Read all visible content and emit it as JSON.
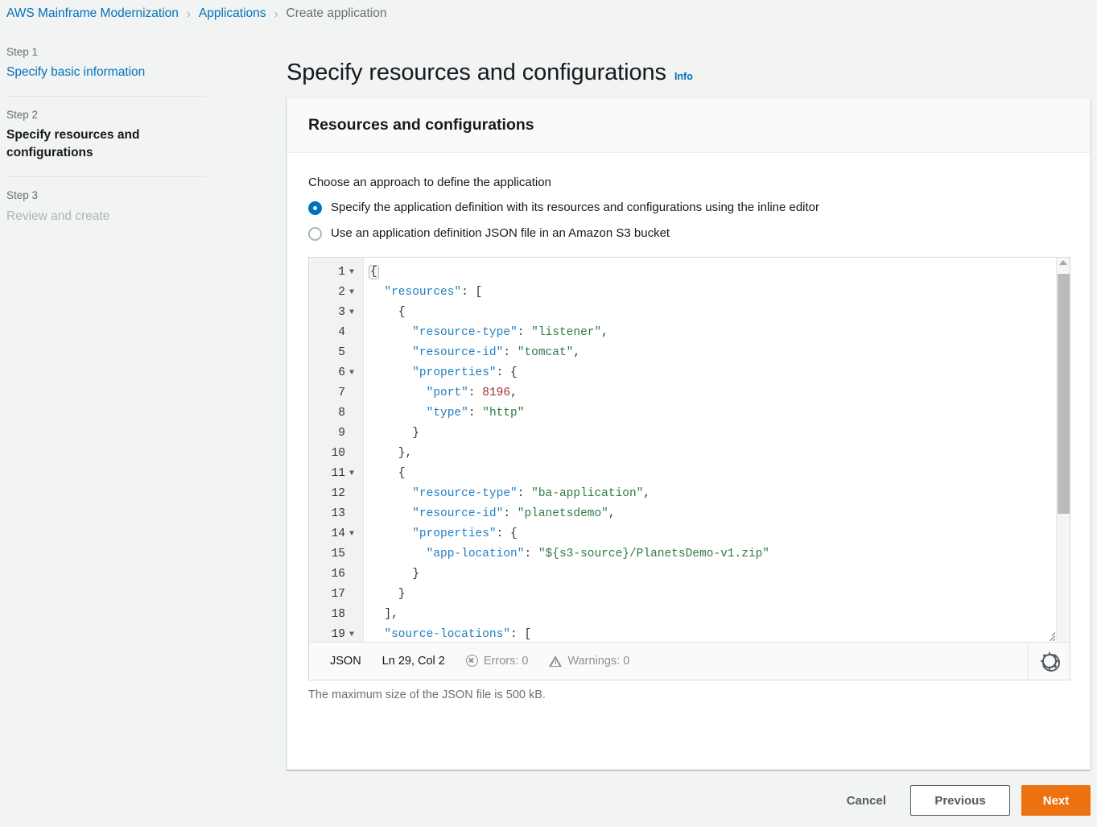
{
  "breadcrumb": {
    "items": [
      {
        "label": "AWS Mainframe Modernization",
        "current": false
      },
      {
        "label": "Applications",
        "current": false
      },
      {
        "label": "Create application",
        "current": true
      }
    ],
    "separator": "›"
  },
  "wizard": {
    "steps": [
      {
        "num": "Step 1",
        "title": "Specify basic information",
        "state": "link"
      },
      {
        "num": "Step 2",
        "title": "Specify resources and configurations",
        "state": "active"
      },
      {
        "num": "Step 3",
        "title": "Review and create",
        "state": "disabled"
      }
    ]
  },
  "page": {
    "heading": "Specify resources and configurations",
    "info_label": "Info"
  },
  "panel": {
    "title": "Resources and configurations",
    "approach_label": "Choose an approach to define the application",
    "options": [
      {
        "label": "Specify the application definition with its resources and configurations using the inline editor",
        "checked": true
      },
      {
        "label": "Use an application definition JSON file in an Amazon S3 bucket",
        "checked": false
      }
    ],
    "max_size_note": "The maximum size of the JSON file is 500 kB."
  },
  "editor": {
    "language": "JSON",
    "cursor_position": "Ln 29, Col 2",
    "errors_label": "Errors: 0",
    "warnings_label": "Warnings: 0",
    "settings_icon": "gear-icon",
    "lines": [
      {
        "n": "1",
        "fold": true,
        "tokens": [
          {
            "t": "{",
            "c": "punc",
            "hl": true
          }
        ]
      },
      {
        "n": "2",
        "fold": true,
        "tokens": [
          {
            "t": "  ",
            "c": "punc"
          },
          {
            "t": "\"resources\"",
            "c": "key"
          },
          {
            "t": ": [",
            "c": "punc"
          }
        ]
      },
      {
        "n": "3",
        "fold": true,
        "tokens": [
          {
            "t": "    {",
            "c": "punc"
          }
        ]
      },
      {
        "n": "4",
        "fold": false,
        "tokens": [
          {
            "t": "      ",
            "c": "punc"
          },
          {
            "t": "\"resource-type\"",
            "c": "key"
          },
          {
            "t": ": ",
            "c": "punc"
          },
          {
            "t": "\"listener\"",
            "c": "str"
          },
          {
            "t": ",",
            "c": "punc"
          }
        ]
      },
      {
        "n": "5",
        "fold": false,
        "tokens": [
          {
            "t": "      ",
            "c": "punc"
          },
          {
            "t": "\"resource-id\"",
            "c": "key"
          },
          {
            "t": ": ",
            "c": "punc"
          },
          {
            "t": "\"tomcat\"",
            "c": "str"
          },
          {
            "t": ",",
            "c": "punc"
          }
        ]
      },
      {
        "n": "6",
        "fold": true,
        "tokens": [
          {
            "t": "      ",
            "c": "punc"
          },
          {
            "t": "\"properties\"",
            "c": "key"
          },
          {
            "t": ": {",
            "c": "punc"
          }
        ]
      },
      {
        "n": "7",
        "fold": false,
        "tokens": [
          {
            "t": "        ",
            "c": "punc"
          },
          {
            "t": "\"port\"",
            "c": "key"
          },
          {
            "t": ": ",
            "c": "punc"
          },
          {
            "t": "8196",
            "c": "num"
          },
          {
            "t": ",",
            "c": "punc"
          }
        ]
      },
      {
        "n": "8",
        "fold": false,
        "tokens": [
          {
            "t": "        ",
            "c": "punc"
          },
          {
            "t": "\"type\"",
            "c": "key"
          },
          {
            "t": ": ",
            "c": "punc"
          },
          {
            "t": "\"http\"",
            "c": "str"
          }
        ]
      },
      {
        "n": "9",
        "fold": false,
        "tokens": [
          {
            "t": "      }",
            "c": "punc"
          }
        ]
      },
      {
        "n": "10",
        "fold": false,
        "tokens": [
          {
            "t": "    },",
            "c": "punc"
          }
        ]
      },
      {
        "n": "11",
        "fold": true,
        "tokens": [
          {
            "t": "    {",
            "c": "punc"
          }
        ]
      },
      {
        "n": "12",
        "fold": false,
        "tokens": [
          {
            "t": "      ",
            "c": "punc"
          },
          {
            "t": "\"resource-type\"",
            "c": "key"
          },
          {
            "t": ": ",
            "c": "punc"
          },
          {
            "t": "\"ba-application\"",
            "c": "str"
          },
          {
            "t": ",",
            "c": "punc"
          }
        ]
      },
      {
        "n": "13",
        "fold": false,
        "tokens": [
          {
            "t": "      ",
            "c": "punc"
          },
          {
            "t": "\"resource-id\"",
            "c": "key"
          },
          {
            "t": ": ",
            "c": "punc"
          },
          {
            "t": "\"planetsdemo\"",
            "c": "str"
          },
          {
            "t": ",",
            "c": "punc"
          }
        ]
      },
      {
        "n": "14",
        "fold": true,
        "tokens": [
          {
            "t": "      ",
            "c": "punc"
          },
          {
            "t": "\"properties\"",
            "c": "key"
          },
          {
            "t": ": {",
            "c": "punc"
          }
        ]
      },
      {
        "n": "15",
        "fold": false,
        "tokens": [
          {
            "t": "        ",
            "c": "punc"
          },
          {
            "t": "\"app-location\"",
            "c": "key"
          },
          {
            "t": ": ",
            "c": "punc"
          },
          {
            "t": "\"${s3-source}/PlanetsDemo-v1.zip\"",
            "c": "str"
          }
        ]
      },
      {
        "n": "16",
        "fold": false,
        "tokens": [
          {
            "t": "      }",
            "c": "punc"
          }
        ]
      },
      {
        "n": "17",
        "fold": false,
        "tokens": [
          {
            "t": "    }",
            "c": "punc"
          }
        ]
      },
      {
        "n": "18",
        "fold": false,
        "tokens": [
          {
            "t": "  ],",
            "c": "punc"
          }
        ]
      },
      {
        "n": "19",
        "fold": true,
        "tokens": [
          {
            "t": "  ",
            "c": "punc"
          },
          {
            "t": "\"source-locations\"",
            "c": "key"
          },
          {
            "t": ": [",
            "c": "punc"
          }
        ]
      }
    ]
  },
  "footer": {
    "cancel_label": "Cancel",
    "previous_label": "Previous",
    "next_label": "Next"
  },
  "colors": {
    "link": "#0073bb",
    "primary_button": "#ec7211",
    "page_background": "#f2f3f3",
    "panel_background": "#ffffff"
  }
}
